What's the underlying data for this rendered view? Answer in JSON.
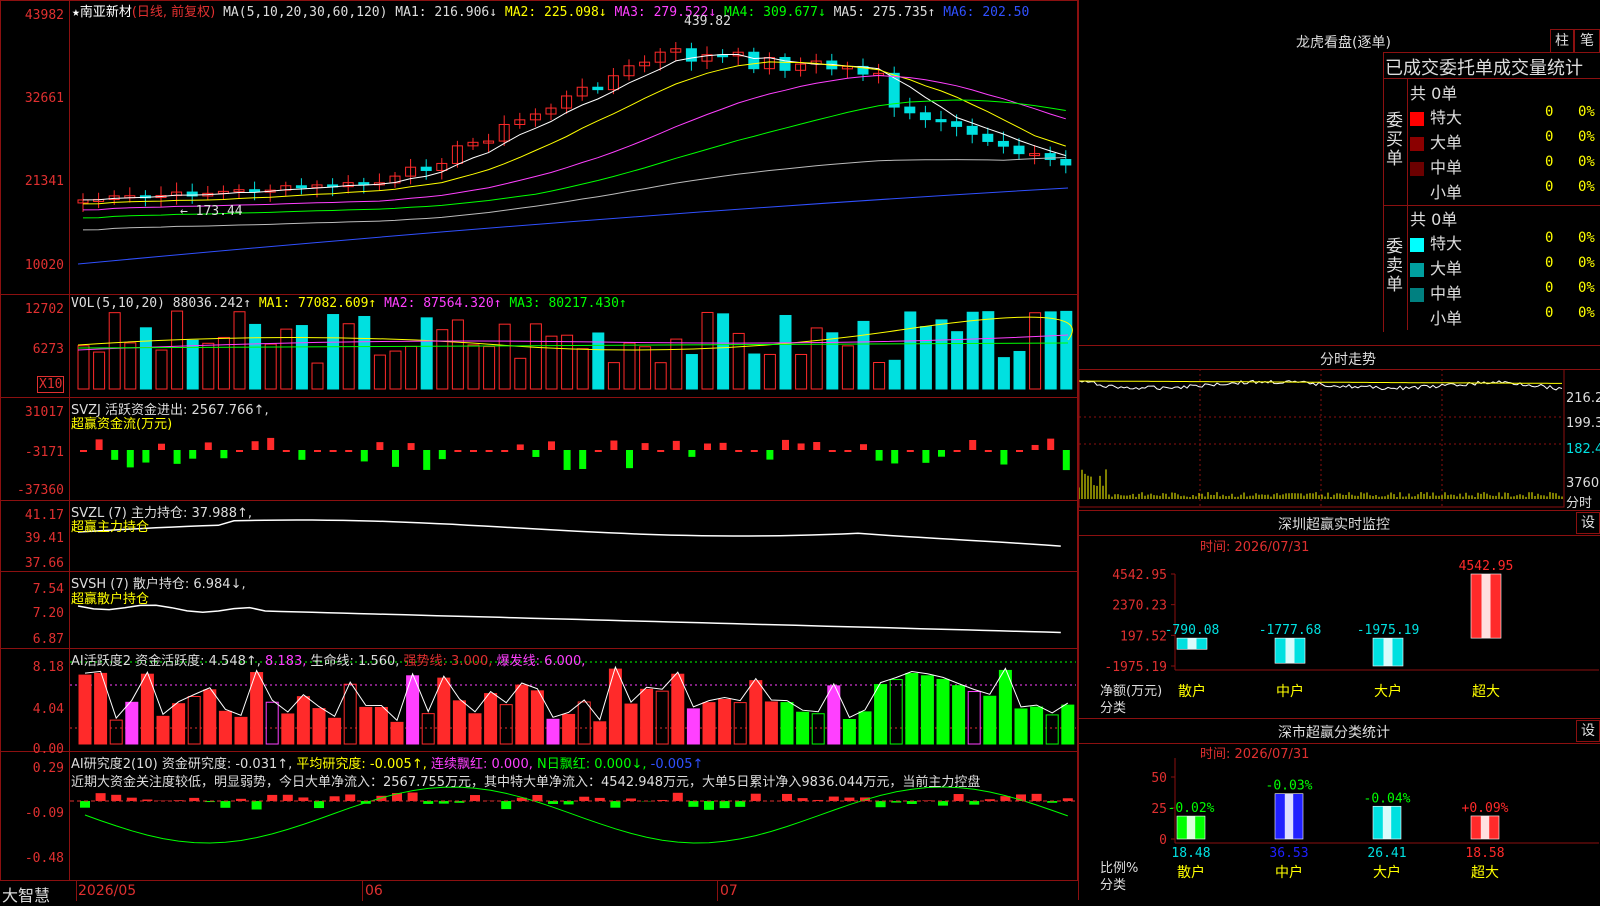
{
  "header": {
    "stock_name": "南亚新材",
    "mode": "(日线, 前复权)",
    "ma_label": "MA(5,10,20,30,60,120)",
    "ma1": "MA1: 216.906↓",
    "ma2": "MA2: 225.098↓",
    "ma3": "MA3: 279.522↓",
    "ma4": "MA4: 309.677↓",
    "ma5": "MA5: 275.735↑",
    "ma6": "MA6: 202.50",
    "high_marker": "439.82",
    "low_marker": "173.44"
  },
  "price_axis": [
    "43982",
    "32661",
    "21341",
    "10020"
  ],
  "vol": {
    "label": "VOL(5,10,20)",
    "val": "88036.242↑",
    "ma1": "MA1: 77082.609↑",
    "ma2": "MA2: 87564.320↑",
    "ma3": "MA3: 80217.430↑",
    "axis": [
      "12702",
      "6273"
    ],
    "unit": "X10"
  },
  "svzj": {
    "label": "SVZJ  活跃资金进出: 2567.766↑,",
    "sub": "超赢资金流(万元)",
    "axis": [
      "31017",
      "-3171",
      "-37360"
    ]
  },
  "svzl": {
    "label": "SVZL (7) 主力持仓: 37.988↑,",
    "sub": "超赢主力持仓",
    "axis": [
      "41.17",
      "39.41",
      "37.66"
    ]
  },
  "svsh": {
    "label": "SVSH (7) 散户持仓: 6.984↓,",
    "sub": "超赢散户持仓",
    "axis": [
      "7.54",
      "7.20",
      "6.87"
    ]
  },
  "ai1": {
    "label": "AI活跃度2 资金活跃度: 4.548↑,",
    "v2": "8.183,",
    "life": "生命线: 1.560,",
    "strong": "强势线: 3.000,",
    "burst": "爆发线: 6.000,",
    "axis": [
      "8.18",
      "4.04",
      "0.00"
    ]
  },
  "ai2": {
    "label": "AI研究度2(10) 资金研究度: -0.031↑,",
    "avg": "平均研究度: -0.005↑,",
    "cont": "连续飘红: 0.000,",
    "nday": "N日飘红: 0.000↓,",
    "last": "-0.005↑",
    "axis": [
      "0.29",
      "-0.09",
      "-0.48"
    ],
    "text": "近期大资金关注度较低，明显弱势，今日大单净流入：2567.755万元，其中特大单净流入：4542.948万元，大单5日累计净入9836.044万元，当前主力控盘"
  },
  "bottom": {
    "brand": "大智慧",
    "dates": [
      "2026/05",
      "06",
      "07"
    ]
  },
  "right": {
    "lhb_title": "龙虎看盘(逐单)",
    "btn_zhu": "柱",
    "btn_bi": "笔",
    "tabs": "已成交委托单成交量统计",
    "buy_side": "委买单",
    "sell_side": "委卖单",
    "buy_total": "共 0单",
    "sell_total": "共 0单",
    "rows": [
      "特大",
      "大单",
      "中单",
      "小单"
    ],
    "zero": "0",
    "zero_pct": "0%",
    "fs_title": "分时走势",
    "fs_axis": [
      "216.2",
      "199.3",
      "182.4",
      "3760",
      "分时"
    ],
    "sz_title": "深圳超赢实时监控",
    "sz_btn": "设",
    "sz_time": "时间: 2026/07/31",
    "sz_axis": [
      "4542.95",
      "2370.23",
      "197.52",
      "-1975.19"
    ],
    "sz_net": "净额(万元)",
    "sz_cat": "分类",
    "sz_cats": [
      "散户",
      "中户",
      "大户",
      "超大"
    ],
    "sz_vals": [
      "-790.08",
      "-1777.68",
      "-1975.19",
      "4542.95"
    ],
    "sc_title": "深市超赢分类统计",
    "sc_btn": "设",
    "sc_time": "时间: 2026/07/31",
    "sc_axis": [
      "75",
      "50",
      "25",
      "0"
    ],
    "sc_ratio": "比例%",
    "sc_cat": "分类",
    "sc_cats": [
      "散户",
      "中户",
      "大户",
      "超大"
    ],
    "sc_vals": [
      "18.48",
      "36.53",
      "26.41",
      "18.58"
    ],
    "sc_chg": [
      "-0.02%",
      "-0.03%",
      "-0.04%",
      "+0.09%"
    ]
  },
  "colors": {
    "up": "#ff2a2a",
    "down": "#00e0e0",
    "green": "#00ff00",
    "frame": "#8b1010",
    "yellow": "#ffff00",
    "magenta": "#ff40ff"
  },
  "chart_data": [
    {
      "type": "bar",
      "title": "深圳超赢实时监控",
      "categories": [
        "散户",
        "中户",
        "大户",
        "超大"
      ],
      "values": [
        -790.08,
        -1777.68,
        -1975.19,
        4542.95
      ],
      "ylabel": "净额(万元)",
      "ylim": [
        -1975.19,
        4542.95
      ]
    },
    {
      "type": "bar",
      "title": "深市超赢分类统计",
      "categories": [
        "散户",
        "中户",
        "大户",
        "超大"
      ],
      "values": [
        18.48,
        36.53,
        26.41,
        18.58
      ],
      "ylabel": "比例%",
      "ylim": [
        0,
        75
      ]
    }
  ]
}
